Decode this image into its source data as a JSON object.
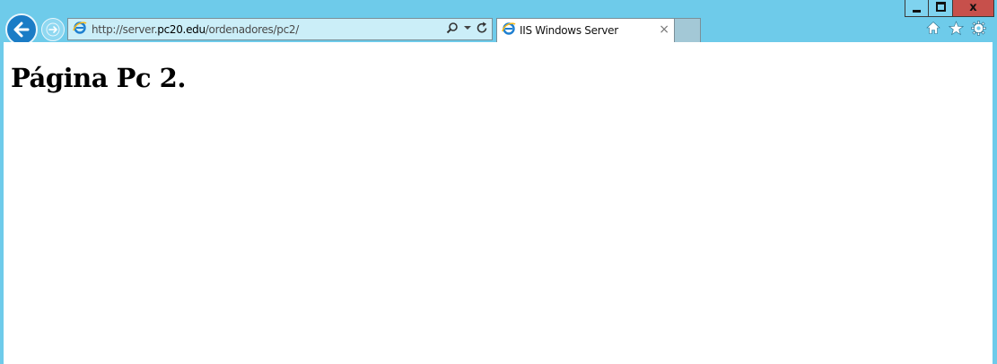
{
  "window": {
    "minimize_label": "",
    "maximize_label": "",
    "close_label": "x"
  },
  "address_bar": {
    "url_prefix": "http://server.",
    "url_domain": "pc20.edu",
    "url_path": "/ordenadores/pc2/"
  },
  "tabs": [
    {
      "title": "IIS Windows Server",
      "close_label": "×",
      "active": true
    }
  ],
  "icons": {
    "back": "back-arrow-icon",
    "forward": "forward-arrow-icon",
    "page": "internet-explorer-icon",
    "search": "search-icon",
    "dropdown": "dropdown-arrow-icon",
    "refresh": "refresh-icon",
    "home": "home-icon",
    "favorites": "star-icon",
    "tools": "gear-icon"
  },
  "page": {
    "heading": "Página Pc 2."
  },
  "colors": {
    "frame": "#6ecbea",
    "back_button": "#1a7cc6",
    "close_button": "#c7504b",
    "address_bar": "#cbeef8"
  }
}
